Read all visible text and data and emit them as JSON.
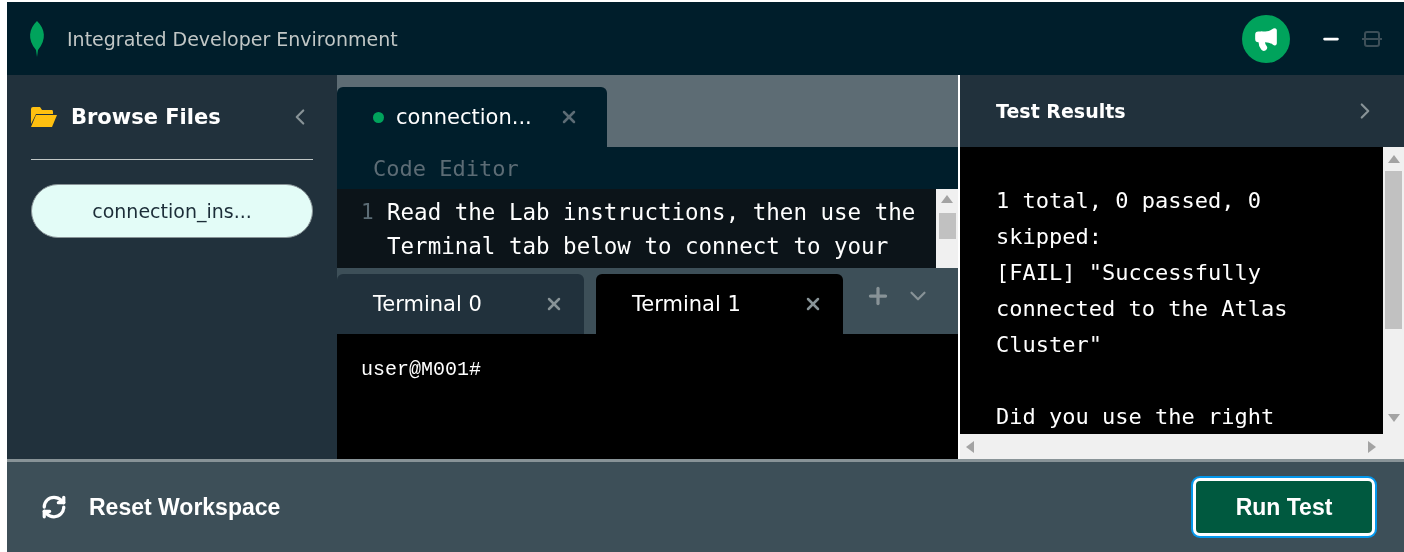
{
  "header": {
    "title": "Integrated Developer Environment"
  },
  "sidebar": {
    "title": "Browse Files",
    "files": [
      {
        "label": "connection_ins...",
        "selected": true
      }
    ]
  },
  "editor": {
    "tabs": [
      {
        "label": "connection...",
        "selected": true,
        "modified": true
      }
    ],
    "label": "Code Editor",
    "code": [
      {
        "number": "1",
        "lines": [
          "Read the Lab instructions, then use the",
          "Terminal tab below to connect to your"
        ]
      }
    ]
  },
  "terminal": {
    "tabs": [
      {
        "label": "Terminal 0",
        "selected": false
      },
      {
        "label": "Terminal 1",
        "selected": true
      }
    ],
    "prompt": "user@M001#"
  },
  "test_results": {
    "title": "Test Results",
    "output": [
      [
        "1 total, 0 passed, 0",
        "skipped:",
        "[FAIL] \"Successfully",
        "connected to the Atlas",
        "Cluster\""
      ],
      [
        "Did you use the right"
      ]
    ]
  },
  "footer": {
    "reset": "Reset Workspace",
    "run": "Run Test"
  }
}
